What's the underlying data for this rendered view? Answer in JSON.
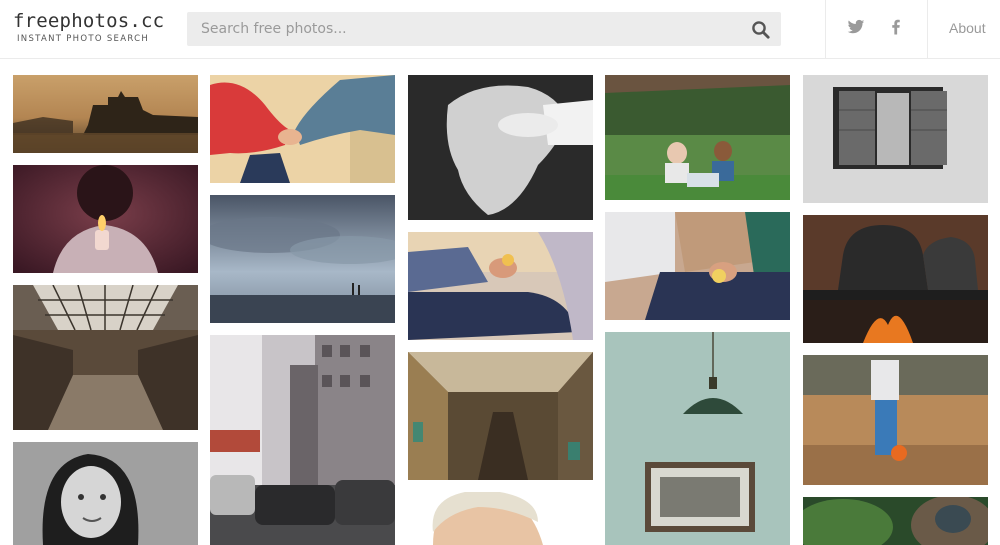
{
  "header": {
    "logo_title": "freephotos.cc",
    "logo_subtitle": "INSTANT PHOTO SEARCH",
    "search_placeholder": "Search free photos...",
    "search_value": "",
    "nav": {
      "about_label": "About"
    }
  },
  "photos": [
    {
      "id": "castle-lake",
      "icon": "photo"
    },
    {
      "id": "man-lighter",
      "icon": "photo"
    },
    {
      "id": "library-hall",
      "icon": "photo"
    },
    {
      "id": "girl-portrait",
      "icon": "photo"
    },
    {
      "id": "holding-hands",
      "icon": "photo"
    },
    {
      "id": "beach-cloudy-sky",
      "icon": "photo"
    },
    {
      "id": "city-street-traffic",
      "icon": "photo"
    },
    {
      "id": "old-baby-hands",
      "icon": "photo"
    },
    {
      "id": "elderly-ball-hand",
      "icon": "photo"
    },
    {
      "id": "abandoned-factory",
      "icon": "photo"
    },
    {
      "id": "blonde-man",
      "icon": "photo"
    },
    {
      "id": "seniors-laptop",
      "icon": "photo"
    },
    {
      "id": "seniors-sitting",
      "icon": "photo"
    },
    {
      "id": "pendant-lamp-wall",
      "icon": "photo"
    },
    {
      "id": "window-shutters",
      "icon": "photo"
    },
    {
      "id": "kettles-fire",
      "icon": "photo"
    },
    {
      "id": "kid-hay-ball",
      "icon": "photo"
    },
    {
      "id": "statue-greenery",
      "icon": "photo"
    }
  ],
  "colors": {
    "search_bg": "#ececec",
    "border": "#ebebeb",
    "muted_text": "#9a9a9a",
    "logo_text": "#333333"
  }
}
